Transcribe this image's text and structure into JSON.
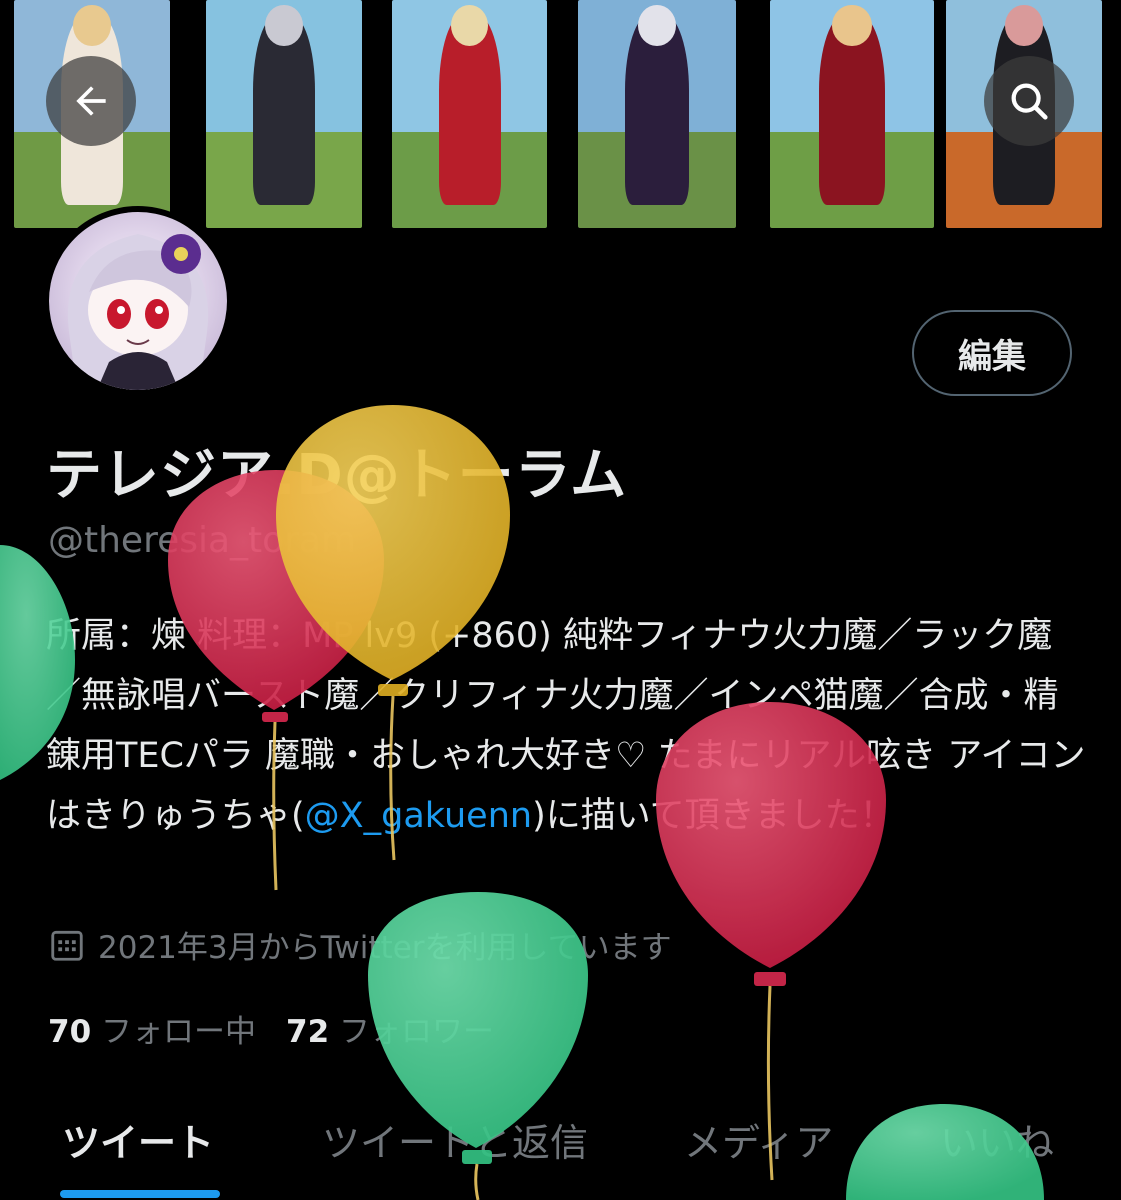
{
  "header": {
    "back_icon": "arrow-left-icon",
    "search_icon": "search-icon",
    "banner_tiles": [
      {
        "sky": "#8fb7d8",
        "ground": "#6f9a45",
        "figure": "#efe6da",
        "hair": "#e8c98f"
      },
      {
        "sky": "#86c2e0",
        "ground": "#79a64a",
        "figure": "#2a2a34",
        "hair": "#c9c9d2"
      },
      {
        "sky": "#8fc6e4",
        "ground": "#6c9c48",
        "figure": "#b81e2a",
        "hair": "#e9d8a8"
      },
      {
        "sky": "#7fb0d6",
        "ground": "#6a9147",
        "figure": "#2b1e3c",
        "hair": "#e2e2ea"
      },
      {
        "sky": "#8ec4e6",
        "ground": "#6e9e46",
        "figure": "#8b1420",
        "hair": "#e9c58c"
      },
      {
        "sky": "#8fbfdc",
        "ground": "#c9692a",
        "figure": "#1d1d22",
        "hair": "#d99a9a"
      }
    ]
  },
  "profile": {
    "avatar_alt": "profile avatar",
    "edit_button": "編集",
    "display_name": "テレジア.D@トーラム",
    "handle": "@theresia_toram",
    "bio_before_mention": "所属：煉 料理：MP lv9 (+860) 純粋フィナウ火力魔／ラック魔／無詠唱バースト魔／クリフィナ火力魔／インペ猫魔／合成・精錬用TECパラ 魔職・おしゃれ大好き♡ たまにリアル呟き アイコンはきりゅうちゃ(",
    "bio_mention": "@X_gakuenn",
    "bio_after_mention": ")に描いて頂きました！",
    "joined": "2021年3月からTwitterを利用しています",
    "following_count": "70",
    "following_label": "フォロー中",
    "followers_count": "72",
    "followers_label": "フォロワー"
  },
  "tabs": [
    {
      "label": "ツイート",
      "active": true
    },
    {
      "label": "ツイートと返信",
      "active": false
    },
    {
      "label": "メディア",
      "active": false
    },
    {
      "label": "いいね",
      "active": false
    }
  ],
  "colors": {
    "accent": "#1d9bf0",
    "balloon_red": "#d92a4f",
    "balloon_yellow": "#e9b92c",
    "balloon_green": "#3cc98a"
  }
}
